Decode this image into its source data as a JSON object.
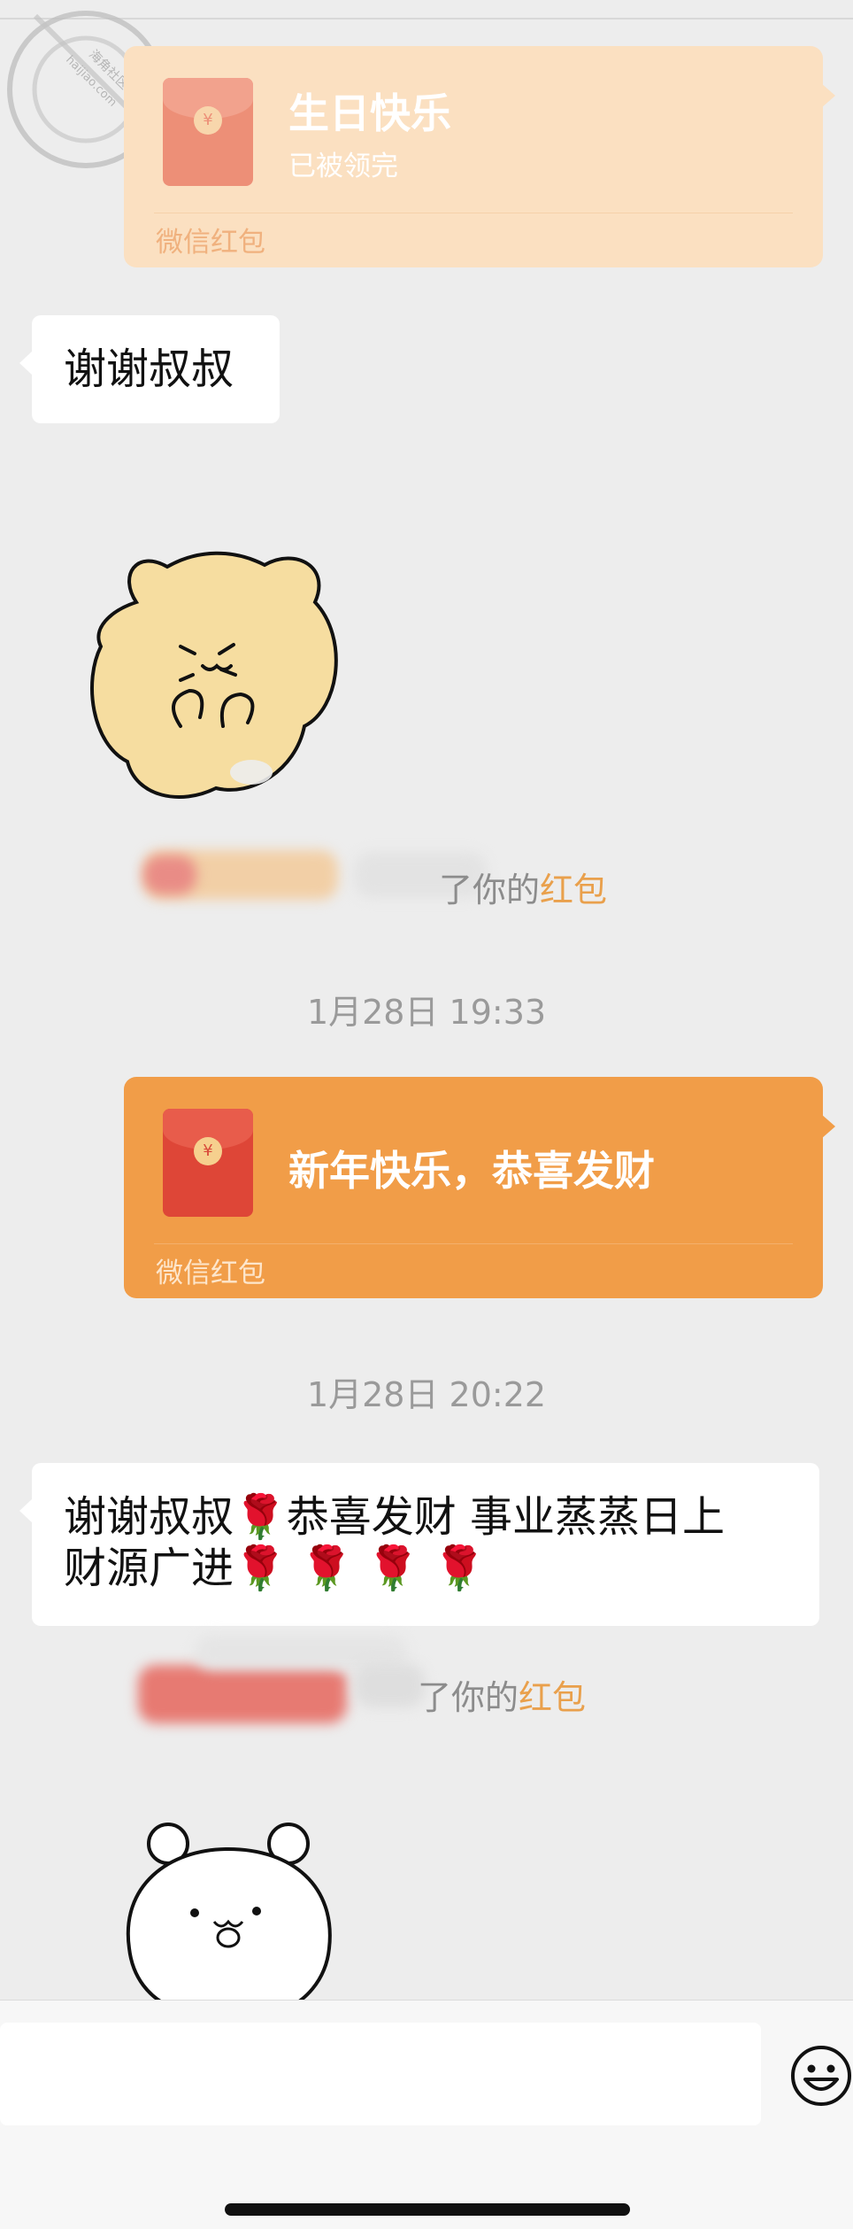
{
  "watermark": {
    "text": "海角社区",
    "domain": "haijiao.com"
  },
  "messages": {
    "red_packet_1": {
      "title": "生日快乐",
      "status": "已被领完",
      "footer": "微信红包",
      "coin": "¥"
    },
    "bubble_1": {
      "text": "谢谢叔叔"
    },
    "notice_1": {
      "prefix": "了你的",
      "highlight": "红包"
    },
    "timestamp_1": "1月28日 19:33",
    "red_packet_2": {
      "title": "新年快乐，恭喜发财",
      "footer": "微信红包",
      "coin": "¥"
    },
    "timestamp_2": "1月28日 20:22",
    "bubble_2": {
      "line1_text": "谢谢叔叔",
      "line1_rest": "恭喜发财 事业蒸蒸日上",
      "line2_text": "财源广进",
      "rose": "🌹"
    },
    "notice_2": {
      "prefix": "了你的",
      "highlight": "红包"
    }
  },
  "colors": {
    "background": "#ededed",
    "red_packet_opened": "#fbe0c1",
    "red_packet_new": "#f19d48",
    "highlight": "#e9a04c"
  },
  "icons": {
    "input_emoji": "emoji-face-icon"
  }
}
